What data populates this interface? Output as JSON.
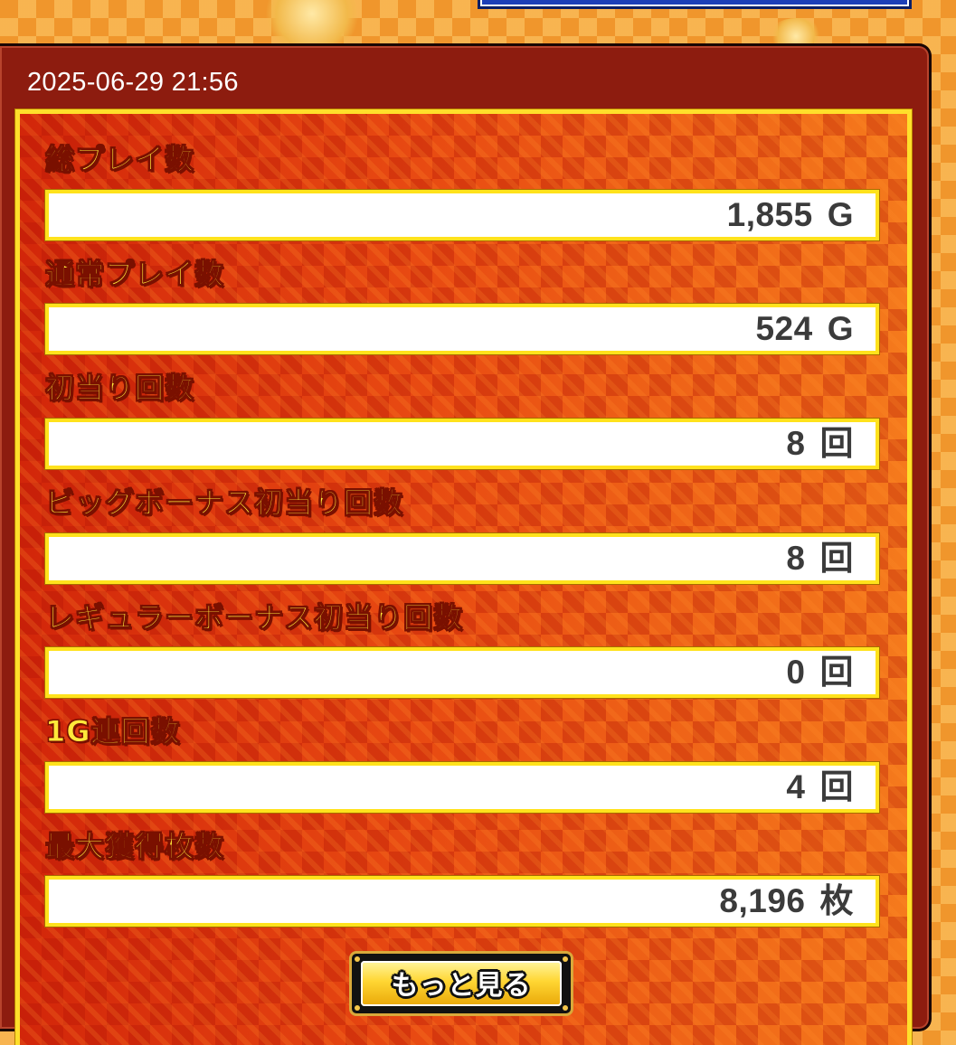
{
  "header": {
    "timestamp": "2025-06-29 21:56"
  },
  "stats": [
    {
      "label": "総プレイ数",
      "value": "1,855",
      "unit": "G"
    },
    {
      "label": "通常プレイ数",
      "value": "524",
      "unit": "G"
    },
    {
      "label": "初当り回数",
      "value": "8",
      "unit": "回"
    },
    {
      "label": "ビッグボーナス初当り回数",
      "value": "8",
      "unit": "回"
    },
    {
      "label": "レギュラーボーナス初当り回数",
      "value": "0",
      "unit": "回"
    },
    {
      "label": "1G連回数",
      "value": "4",
      "unit": "回"
    },
    {
      "label": "最大獲得枚数",
      "value": "8,196",
      "unit": "枚"
    }
  ],
  "footer": {
    "more_label": "もっと見る"
  },
  "colors": {
    "panel_bg": "#8d1c0f",
    "label_yellow": "#ffe93a",
    "box_border": "#ffe21c",
    "value_text": "#3b3b3b"
  }
}
